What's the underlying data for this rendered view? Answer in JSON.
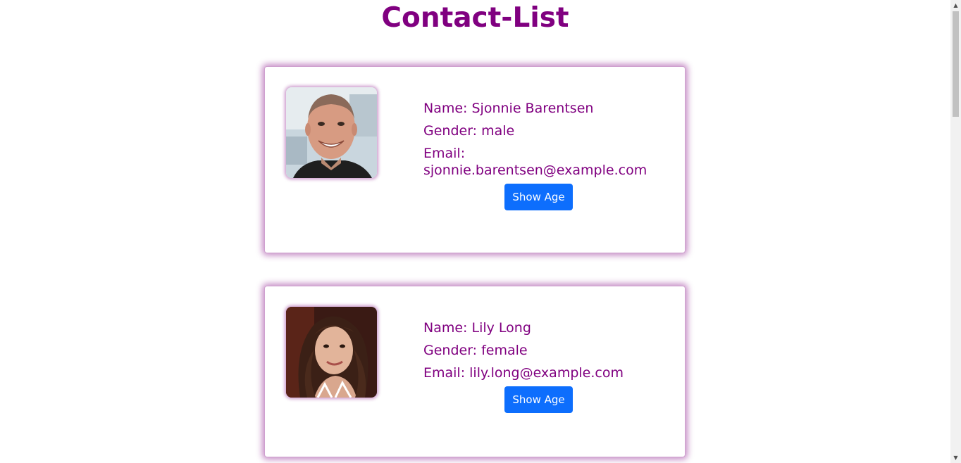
{
  "page": {
    "title": "Contact-List"
  },
  "contacts": [
    {
      "name_line": "Name: Sjonnie Barentsen",
      "gender_line": "Gender: male",
      "email_label": "Email:",
      "email_value": "sjonnie.barentsen@example.com",
      "button_label": "Show Age",
      "photo": "man-portrait"
    },
    {
      "name_line": "Name: Lily Long",
      "gender_line": "Gender: female",
      "email_line": "Email: lily.long@example.com",
      "button_label": "Show Age",
      "photo": "woman-portrait"
    }
  ],
  "colors": {
    "title": "#800080",
    "text": "#800080",
    "button": "#0d6efd",
    "card_glow": "#800080"
  },
  "icons": {
    "scroll_up": "▲",
    "scroll_down": "▼"
  }
}
